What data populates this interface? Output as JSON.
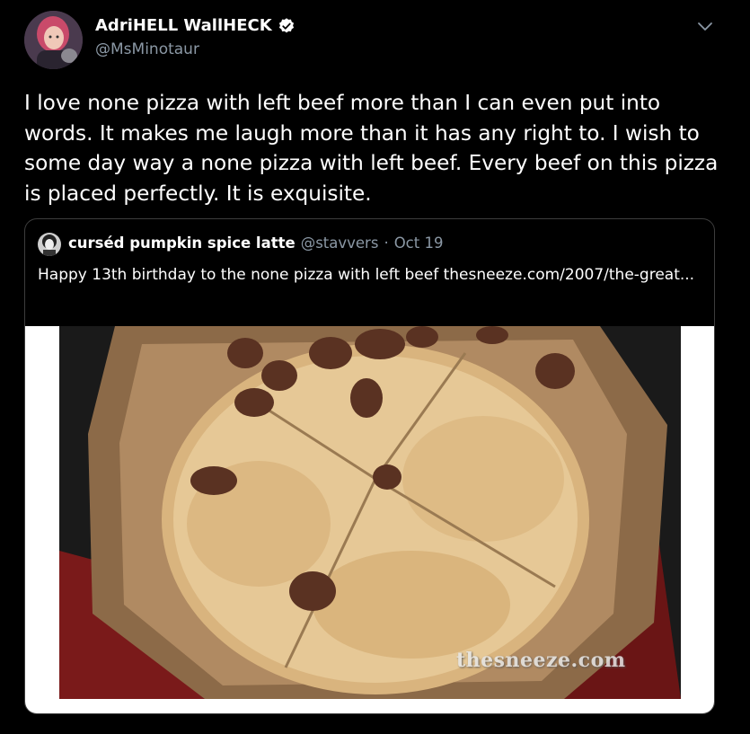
{
  "tweet": {
    "author": {
      "display_name": "AdriHELL WallHECK",
      "handle": "@MsMinotaur",
      "verified": true
    },
    "text": "I love none pizza with left beef more than I can even put into words. It makes me laugh more than it has any right to. I wish to some day way a none pizza with left beef. Every beef on this pizza is placed perfectly. It is exquisite.",
    "menu_icon": "chevron-down-icon"
  },
  "quoted_tweet": {
    "display_name": "curséd pumpkin spice latte",
    "handle": "@stavvers",
    "separator": "·",
    "date": "Oct 19",
    "text": "Happy 13th birthday to the none pizza with left beef thesneeze.com/2007/the-great...",
    "media": {
      "watermark": "thesneeze.com"
    }
  },
  "colors": {
    "background": "#000000",
    "text_primary": "#ffffff",
    "text_secondary": "#8b98a5",
    "card_border": "#3d3d3d"
  }
}
